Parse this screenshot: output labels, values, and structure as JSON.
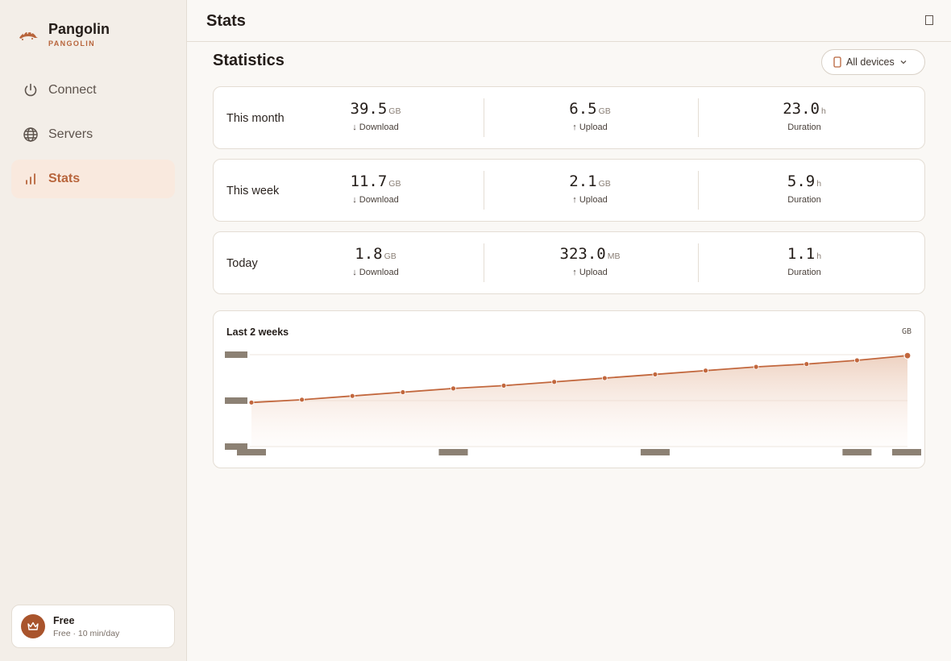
{
  "app": {
    "name": "Pangolin",
    "subtitle": "PANGOLIN"
  },
  "nav": [
    {
      "label": "Connect",
      "icon": "power-icon",
      "active": false
    },
    {
      "label": "Servers",
      "icon": "globe-icon",
      "active": false
    },
    {
      "label": "Stats",
      "icon": "bar-chart-icon",
      "active": true
    }
  ],
  "plan": {
    "title": "Free",
    "subtitle": "Free · 10 min/day"
  },
  "header": {
    "title": "Stats"
  },
  "statistics": {
    "title": "Statistics",
    "device_filter": "All devices",
    "rows": [
      {
        "label": "This month",
        "download": {
          "value": "39.5",
          "unit": "GB",
          "label": "↓ Download"
        },
        "upload": {
          "value": "6.5",
          "unit": "GB",
          "label": "↑ Upload"
        },
        "duration": {
          "value": "23.0",
          "unit": "h",
          "label": "Duration"
        }
      },
      {
        "label": "This week",
        "download": {
          "value": "11.7",
          "unit": "GB",
          "label": "↓ Download"
        },
        "upload": {
          "value": "2.1",
          "unit": "GB",
          "label": "↑ Upload"
        },
        "duration": {
          "value": "5.9",
          "unit": "h",
          "label": "Duration"
        }
      },
      {
        "label": "Today",
        "download": {
          "value": "1.8",
          "unit": "GB",
          "label": "↓ Download"
        },
        "upload": {
          "value": "323.0",
          "unit": "MB",
          "label": "↑ Upload"
        },
        "duration": {
          "value": "1.1",
          "unit": "h",
          "label": "Duration"
        }
      }
    ]
  },
  "colors": {
    "accent": "#b8653c",
    "line": "#c2673d",
    "grid": "#ece5dd",
    "placeholder": "#8c8174"
  },
  "chart_data": {
    "type": "area",
    "title": "Last 2 weeks",
    "ylabel": "GB",
    "x": [
      1,
      2,
      3,
      4,
      5,
      6,
      7,
      8,
      9,
      10,
      11,
      12,
      13,
      14
    ],
    "series": [
      {
        "values": [
          0.47,
          0.5,
          0.54,
          0.58,
          0.62,
          0.65,
          0.69,
          0.73,
          0.77,
          0.81,
          0.85,
          0.88,
          0.92,
          0.97
        ]
      }
    ],
    "ylim": [
      0,
      0.98
    ],
    "grid": true,
    "ytick_count": 3,
    "xtick_positions": [
      1,
      5,
      9,
      13,
      14
    ]
  }
}
